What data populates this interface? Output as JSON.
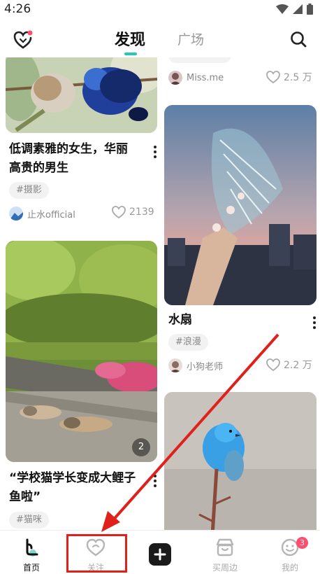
{
  "status_bar": {
    "time": "4:26"
  },
  "header": {
    "tab_active": "发现",
    "tab_inactive": "广场",
    "accent_color": "#20c9b8",
    "left_icon": "heart-bell-icon",
    "right_icon": "search-icon"
  },
  "feed": {
    "left": [
      {
        "title_lines": [
          "低调素雅的女生，华丽",
          "高贵的男生"
        ],
        "tag": "#摄影",
        "author": "止水official",
        "likes": "2139"
      },
      {
        "title_lines": [
          "“学校猫学长变成大鲤子",
          "鱼啦”"
        ],
        "tag": "#猫咪",
        "image_count": "2"
      }
    ],
    "right": [
      {
        "author": "Miss.me",
        "likes": "2.5 万"
      },
      {
        "title_lines": [
          "水扇"
        ],
        "tag": "#浪漫",
        "author": "小狗老师",
        "likes": "2.2 万"
      }
    ]
  },
  "bottom_nav": {
    "tabs": [
      {
        "label": "首页",
        "icon": "home-icon",
        "active": true
      },
      {
        "label": "关注",
        "icon": "heart-follow-icon",
        "active": false
      },
      {
        "label": "",
        "icon": "plus-icon"
      },
      {
        "label": "买周边",
        "icon": "shop-icon",
        "active": false
      },
      {
        "label": "我的",
        "icon": "profile-icon",
        "active": false
      }
    ],
    "badge": "3"
  },
  "annotation": {
    "color": "#e0201b"
  }
}
